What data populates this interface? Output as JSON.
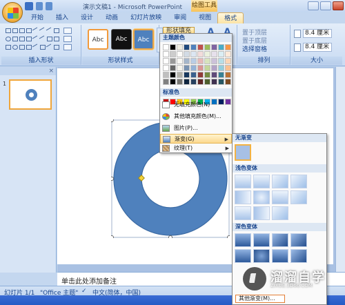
{
  "window": {
    "title": "演示文稿1 - Microsoft PowerPoint",
    "contextual_tab_group": "绘图工具"
  },
  "tabs": [
    {
      "label": "开始"
    },
    {
      "label": "插入"
    },
    {
      "label": "设计"
    },
    {
      "label": "动画"
    },
    {
      "label": "幻灯片放映"
    },
    {
      "label": "审阅"
    },
    {
      "label": "视图"
    },
    {
      "label": "格式",
      "active": true
    }
  ],
  "ribbon": {
    "groups": {
      "insert_shapes": "插入形状",
      "shape_styles": "形状样式",
      "arrange": "排列",
      "size": "大小"
    },
    "style_buttons": [
      "Abc",
      "Abc",
      "Abc"
    ],
    "shape_fill_label": "形状填充",
    "arrange_items": [
      "置于顶层",
      "置于底层",
      "选择窗格"
    ],
    "size": {
      "height": "8.4 厘米",
      "width": "8.4 厘米"
    }
  },
  "fill_menu": {
    "theme_colors_header": "主题颜色",
    "standard_colors_header": "标准色",
    "items": [
      {
        "label": "无填充颜色(N)"
      },
      {
        "label": "其他填充颜色(M)..."
      },
      {
        "label": "图片(P)..."
      },
      {
        "label": "渐变(G)",
        "highlighted": true
      },
      {
        "label": "纹理(T)"
      }
    ],
    "theme_colors": [
      "#ffffff",
      "#000000",
      "#eeece1",
      "#1f497d",
      "#4f81bd",
      "#c0504d",
      "#9bbb59",
      "#8064a2",
      "#4bacc6",
      "#f79646"
    ],
    "standard_colors": [
      "#c00000",
      "#ff0000",
      "#ffc000",
      "#ffff00",
      "#92d050",
      "#00b050",
      "#00b0f0",
      "#0070c0",
      "#002060",
      "#7030a0"
    ]
  },
  "gradient_menu": {
    "no_gradient_header": "无渐变",
    "light_header": "浅色变体",
    "dark_header": "深色变体",
    "more_label": "其他渐变(M)..."
  },
  "slides_pane": {
    "slide_number": "1"
  },
  "notes_placeholder": "单击此处添加备注",
  "status": {
    "slide": "幻灯片 1/1",
    "theme": "\"Office 主题\"",
    "language": "中文(简体，中国)"
  },
  "watermark": {
    "brand": "溜溜自学",
    "url": "ZIXUE.3D66.COM"
  },
  "colors": {
    "shape_fill": "#4f81bd",
    "accent": "#f3b242"
  }
}
